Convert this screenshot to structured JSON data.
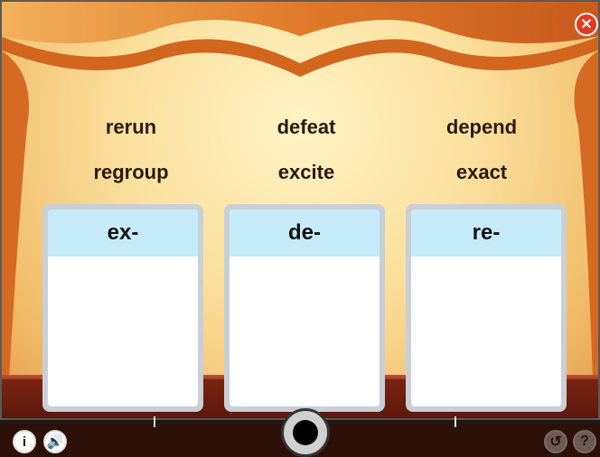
{
  "words": {
    "row1": [
      "rerun",
      "defeat",
      "depend"
    ],
    "row2": [
      "regroup",
      "excite",
      "exact"
    ]
  },
  "boxes": [
    {
      "label": "ex-"
    },
    {
      "label": "de-"
    },
    {
      "label": "re-"
    }
  ],
  "controls": {
    "close_glyph": "✕",
    "info_icon": "person-info-icon",
    "info_glyph": "i",
    "audio_icon": "speaker-icon",
    "audio_glyph": "🔊",
    "back_icon": "back-arrow-icon",
    "back_glyph": "↺",
    "help_icon": "help-icon",
    "help_glyph": "?"
  },
  "colors": {
    "box_header": "#c5ebf8",
    "close": "#e23a1e",
    "curtain": "#e0822e"
  }
}
